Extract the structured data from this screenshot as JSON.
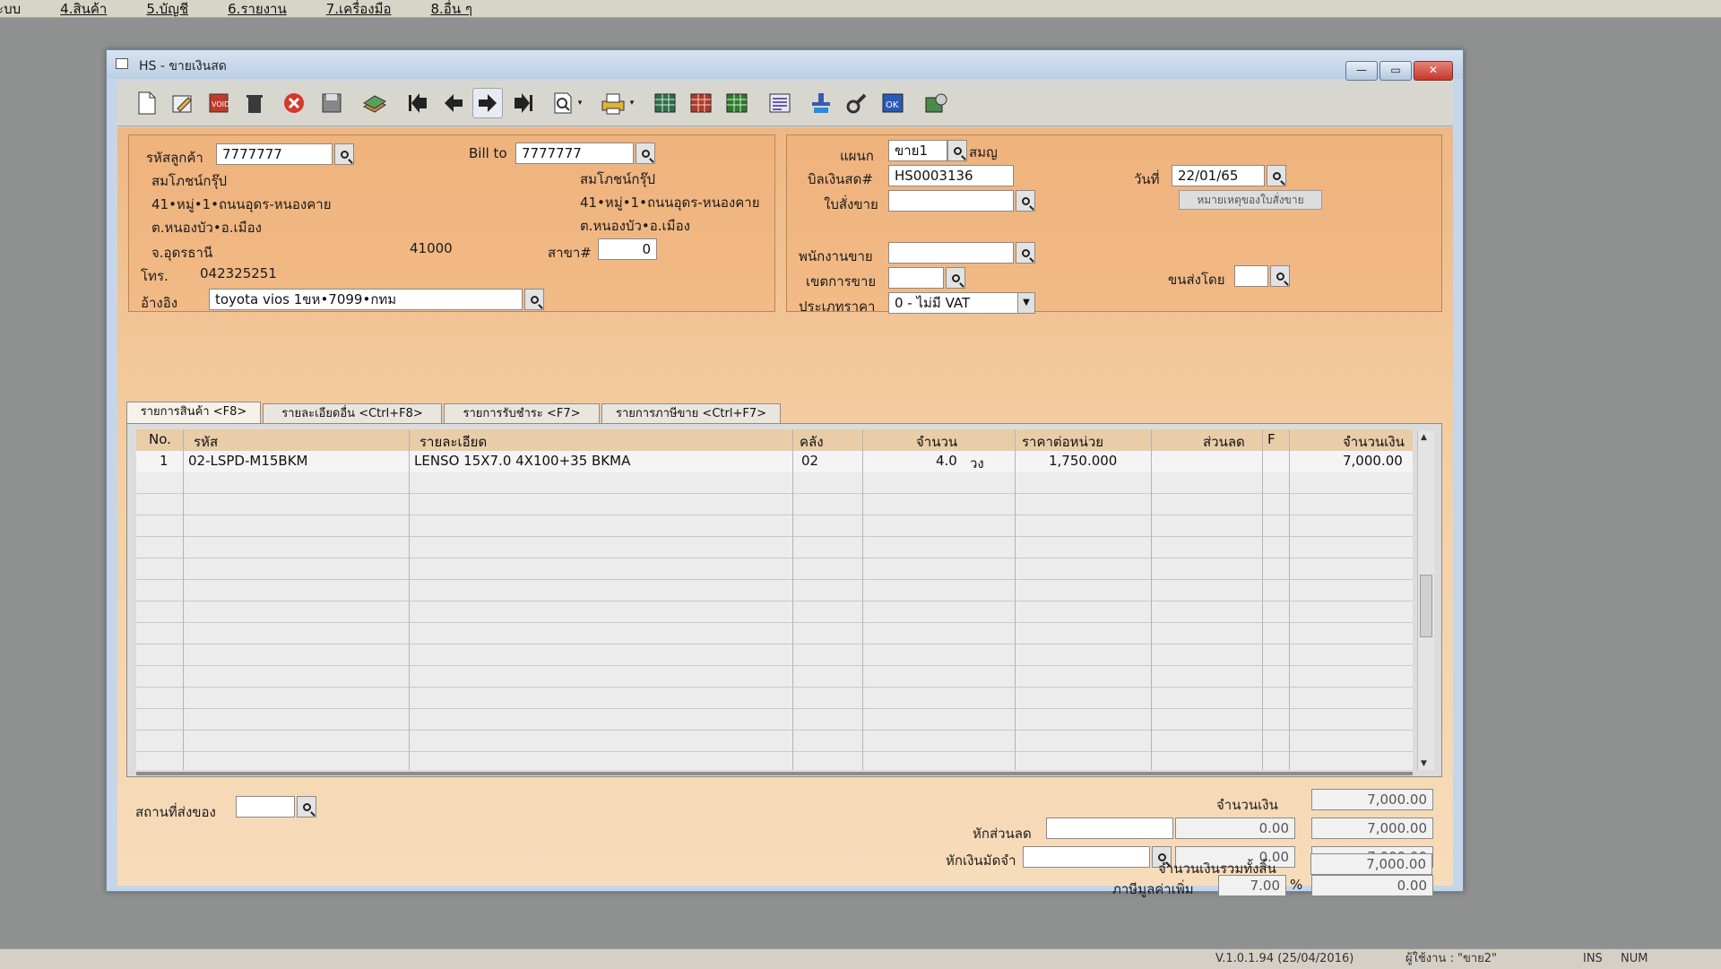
{
  "menu": {
    "items": [
      "ระบบ",
      "4.สินค้า",
      "5.บัญชี",
      "6.รายงาน",
      "7.เครื่องมือ",
      "8.อื่น ๆ"
    ]
  },
  "window": {
    "title": "HS - ขายเงินสด",
    "btn_min": "—",
    "btn_max": "▭",
    "btn_close": "✕"
  },
  "toolbar": {
    "icons": [
      "new-icon",
      "edit-icon",
      "void-icon",
      "delete-icon",
      "cancel-icon",
      "save-icon",
      "copy-icon",
      "first-icon",
      "prev-icon",
      "next-icon",
      "last-icon",
      "find-icon",
      "find-dropdown-icon",
      "print-icon",
      "print-dropdown-icon",
      "table1-icon",
      "table2-icon",
      "table3-icon",
      "report-icon",
      "approve-icon",
      "tools-icon",
      "ok-icon",
      "export-icon"
    ]
  },
  "customer": {
    "code_label": "รหัสลูกค้า",
    "code_value": "7777777",
    "billto_label": "Bill to",
    "billto_value": "7777777",
    "name": "สมโภชน์กรุ๊ป",
    "addr1": "41•หมู่•1•ถนนอุดร-หนองคาย",
    "addr2": "ต.หนองบัว•อ.เมือง",
    "addr3": "จ.อุดรธานี",
    "postcode": "41000",
    "bill_name": "สมโภชน์กรุ๊ป",
    "bill_addr1": "41•หมู่•1•ถนนอุดร-หนองคาย",
    "bill_addr2": "ต.หนองบัว•อ.เมือง",
    "branch_label": "สาขา#",
    "branch_value": "0",
    "phone_label": "โทร.",
    "phone_value": "042325251",
    "ref_label": "อ้างอิง",
    "ref_value": "toyota vios 1ขห•7099•กทม"
  },
  "doc": {
    "dept_label": "แผนก",
    "dept_value": "ขาย1",
    "dept_name": "สมญ",
    "billno_label": "บิลเงินสด#",
    "billno_value": "HS0003136",
    "date_label": "วันที่",
    "date_value": "22/01/65",
    "so_label": "ใบสั่งขาย",
    "so_value": "",
    "so_note_button": "หมายเหตุของใบสั่งขาย",
    "salesman_label": "พนักงานขาย",
    "salesman_value": "",
    "area_label": "เขตการขาย",
    "area_value": "",
    "shipby_label": "ขนส่งโดย",
    "shipby_value": "",
    "pricetype_label": "ประเภทราคา",
    "pricetype_value": "0 - ไม่มี VAT"
  },
  "tabs": [
    "รายการสินค้า <F8>",
    "รายละเอียดอื่น <Ctrl+F8>",
    "รายการรับชำระ <F7>",
    "รายการภาษีขาย <Ctrl+F7>"
  ],
  "grid": {
    "columns": [
      "No.",
      "รหัส",
      "รายละเอียด",
      "คลัง",
      "จำนวน",
      "ราคาต่อหน่วย",
      "ส่วนลด",
      "F",
      "จำนวนเงิน"
    ],
    "rows": [
      {
        "no": "1",
        "code": "02-LSPD-M15BKM",
        "desc": "LENSO  15X7.0 4X100+35 BKMA",
        "wh": "02",
        "qty": "4.0",
        "unit": "วง",
        "price": "1,750.000",
        "discount": "",
        "f": "",
        "amount": "7,000.00"
      }
    ]
  },
  "footer": {
    "ship_place_label": "สถานที่ส่งของ",
    "ship_place_value": "",
    "amount_label": "จำนวนเงิน",
    "amount_value": "7,000.00",
    "discount_label": "หักส่วนลด",
    "discount_text": "",
    "discount_value": "0.00",
    "after_discount": "7,000.00",
    "deposit_label": "หักเงินมัดจำ",
    "deposit_text": "",
    "deposit_value": "0.00",
    "after_deposit": "7,000.00",
    "vat_label": "ภาษีมูลค่าเพิ่ม",
    "vat_rate": "7.00",
    "vat_pct": "%",
    "vat_value": "0.00",
    "total_label": "จำนวนเงินรวมทั้งสิ้น",
    "total_value": "7,000.00"
  },
  "status": {
    "version": "V.1.0.1.94 (25/04/2016)",
    "user": "ผู้ใช้งาน : \"ขาย2\"",
    "ins": "INS",
    "num": "NUM"
  }
}
